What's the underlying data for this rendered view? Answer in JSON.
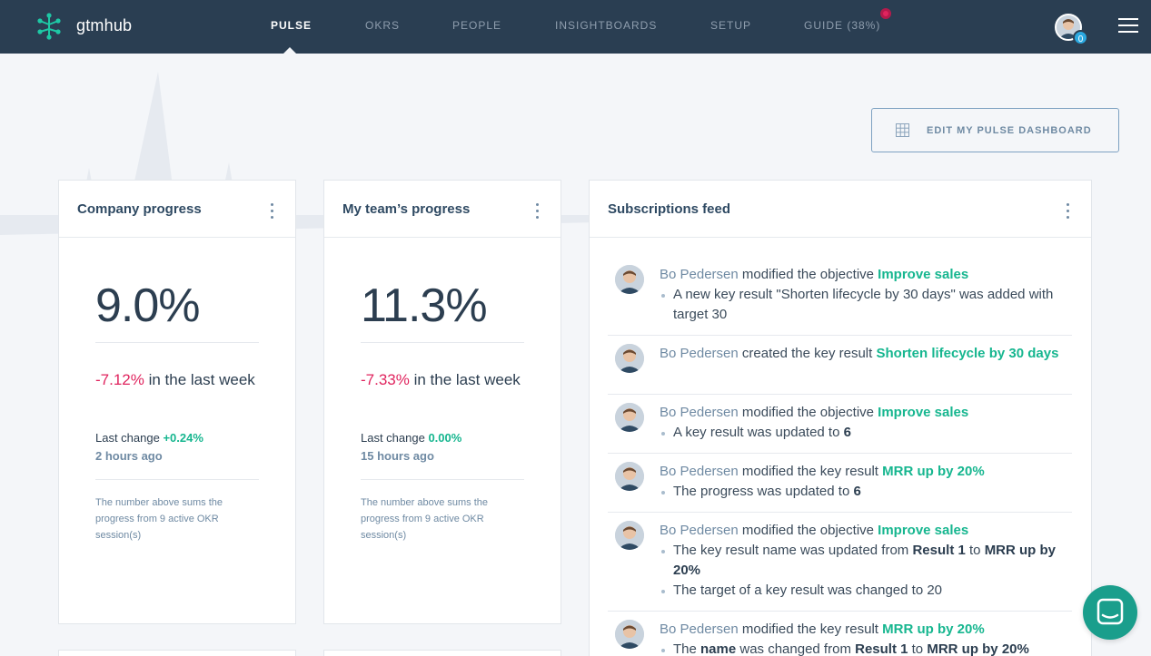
{
  "app": {
    "brand": "gtmhub"
  },
  "nav": {
    "items": [
      {
        "label": "PULSE",
        "active": true
      },
      {
        "label": "OKRS",
        "active": false
      },
      {
        "label": "PEOPLE",
        "active": false
      },
      {
        "label": "INSIGHTBOARDS",
        "active": false
      },
      {
        "label": "SETUP",
        "active": false
      },
      {
        "label": "GUIDE (38%)",
        "active": false
      }
    ],
    "notification_count": "0"
  },
  "toolbar": {
    "edit_label": "EDIT MY PULSE DASHBOARD",
    "edit_icon": "grid-icon"
  },
  "company": {
    "title": "Company progress",
    "percent": "9.0%",
    "delta": "-7.12%",
    "delta_suffix": " in the last week",
    "last_change_label": "Last change ",
    "last_change_value": "+0.24%",
    "ago": "2 hours ago",
    "note": "The number above sums the progress from 9 active OKR session(s)"
  },
  "team": {
    "title": "My team’s progress",
    "percent": "11.3%",
    "delta": "-7.33%",
    "delta_suffix": " in the last week",
    "last_change_label": "Last change ",
    "last_change_value": "0.00%",
    "ago": "15 hours ago",
    "note": "The number above sums the progress from 9 active OKR session(s)"
  },
  "feed": {
    "title": "Subscriptions feed",
    "items": [
      {
        "user": "Bo Pedersen",
        "action": " modified the objective ",
        "target": "Improve sales",
        "details": [
          "A new key result \"Shorten lifecycle by 30 days\" was added with target 30"
        ]
      },
      {
        "user": "Bo Pedersen",
        "action": " created the key result ",
        "target": "Shorten lifecycle by 30 days",
        "details": []
      },
      {
        "user": "Bo Pedersen",
        "action": " modified the objective ",
        "target": "Improve sales",
        "details": [
          {
            "text": "A key result was updated to ",
            "bold": "6"
          }
        ]
      },
      {
        "user": "Bo Pedersen",
        "action": " modified the key result ",
        "target": "MRR up by 20%",
        "details": [
          {
            "text": "The progress was updated to ",
            "bold": "6"
          }
        ]
      },
      {
        "user": "Bo Pedersen",
        "action": " modified the objective ",
        "target": "Improve sales",
        "details": [
          {
            "text": "The key result name was updated from ",
            "bold": "Result 1",
            "mid": " to ",
            "bold2": "MRR up by 20%"
          },
          {
            "text": "The target of a key result was changed to 20"
          }
        ]
      },
      {
        "user": "Bo Pedersen",
        "action": " modified the key result ",
        "target": "MRR up by 20%",
        "details": [
          {
            "text": "The ",
            "bold": "name",
            "mid": " was changed from ",
            "bold2": "Result 1",
            "mid2": " to ",
            "bold3": "MRR up by 20%"
          }
        ]
      }
    ]
  },
  "colors": {
    "nav_bg": "#2a3e52",
    "accent_green": "#16b68f",
    "negative": "#e0245e",
    "muted": "#6f8aa3"
  }
}
